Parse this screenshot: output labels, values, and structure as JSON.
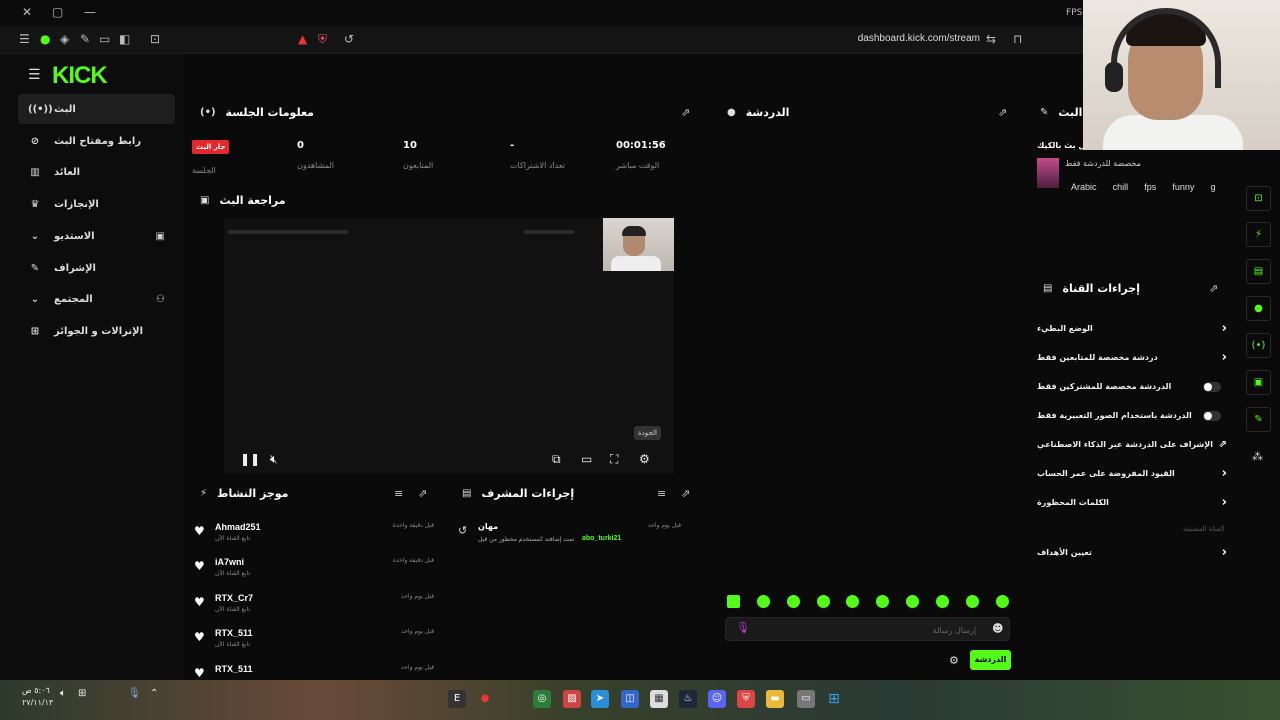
{
  "browser": {
    "url": "dashboard.kick.com/stream",
    "fps_label": "FPS"
  },
  "sidebar": {
    "logo": "KICK",
    "items": [
      {
        "label": "البث",
        "icon": "broadcast-icon"
      },
      {
        "label": "رابط ومفتاح البث",
        "icon": "link-icon"
      },
      {
        "label": "العائد",
        "icon": "chart-icon"
      },
      {
        "label": "الإنجازات",
        "icon": "trophy-icon"
      },
      {
        "label": "الاستديو",
        "icon": "studio-icon"
      },
      {
        "label": "الإشراف",
        "icon": "wrench-icon"
      },
      {
        "label": "المجتمع",
        "icon": "community-icon"
      },
      {
        "label": "الإنزالات و الجوائز",
        "icon": "drops-icon"
      }
    ]
  },
  "session": {
    "title": "معلومات الجلسة",
    "live_badge": "جار البث",
    "session_label": "الجلسة",
    "stats": [
      {
        "value": "0",
        "label": "المشاهدون"
      },
      {
        "value": "10",
        "label": "المتابعون"
      },
      {
        "value": "-",
        "label": "تعداد الاشتراكات"
      },
      {
        "value": "00:01:56",
        "label": "الوقت مباشر"
      }
    ]
  },
  "preview": {
    "title": "مراجعة البث",
    "tooltip": "الجودة"
  },
  "activity": {
    "title": "موجز النشاط",
    "items": [
      {
        "name": "Ahmad251",
        "sub": "تابع القناة الآن",
        "time": "قبل دقيقة واحدة"
      },
      {
        "name": "iA7wni",
        "sub": "تابع القناة الآن",
        "time": "قبل دقيقة واحدة"
      },
      {
        "name": "RTX_Cr7",
        "sub": "تابع القناة الآن",
        "time": "قبل يوم واحد"
      },
      {
        "name": "RTX_511",
        "sub": "تابع القناة الآن",
        "time": "قبل يوم واحد"
      },
      {
        "name": "RTX_511",
        "sub": "",
        "time": "قبل يوم واحد"
      }
    ]
  },
  "modactions": {
    "title": "إجراءات المشرف",
    "entry_name": "مهان",
    "entry_text": "تمت إضافته كمستخدم محظور من قبل",
    "entry_user": "abo_turki21",
    "entry_time": "قبل يوم واحد"
  },
  "chat": {
    "title": "الدردشة",
    "placeholder": "إرسال رسالة",
    "send_label": "الدردشة"
  },
  "stream_info": {
    "title": "البث",
    "stream_title": "اول بث بالكيك",
    "category": "مخصصة للدردشة فقط",
    "tags": [
      "Arabic",
      "chill",
      "fps",
      "funny",
      "g"
    ]
  },
  "channel_actions": {
    "title": "إجراءات القناة",
    "rows": [
      {
        "label": "الوضع البطيء",
        "control": "chevron"
      },
      {
        "label": "دردشة مخصصة للمتابعين فقط",
        "control": "chevron"
      },
      {
        "label": "الدردشة مخصصة للمشتركين فقط",
        "control": "toggle"
      },
      {
        "label": "الدردشة باستخدام الصور التعبيرية فقط",
        "control": "toggle"
      },
      {
        "label": "الإشراف على الدردشة عبر الذكاء الاصطناعي",
        "control": "popout"
      },
      {
        "label": "القيود المفروضة على عمر الحساب",
        "control": "chevron"
      },
      {
        "label": "الكلمات المحظورة",
        "control": "chevron"
      }
    ],
    "faded_label": "القناة المضيفة",
    "goals_label": "تعيين الأهداف"
  },
  "taskbar": {
    "clock_time": "٥:٠٦ ص",
    "clock_date": "٢٧/١١/١٣"
  },
  "colors": {
    "brand": "#53fc18",
    "live": "#e5272e"
  }
}
